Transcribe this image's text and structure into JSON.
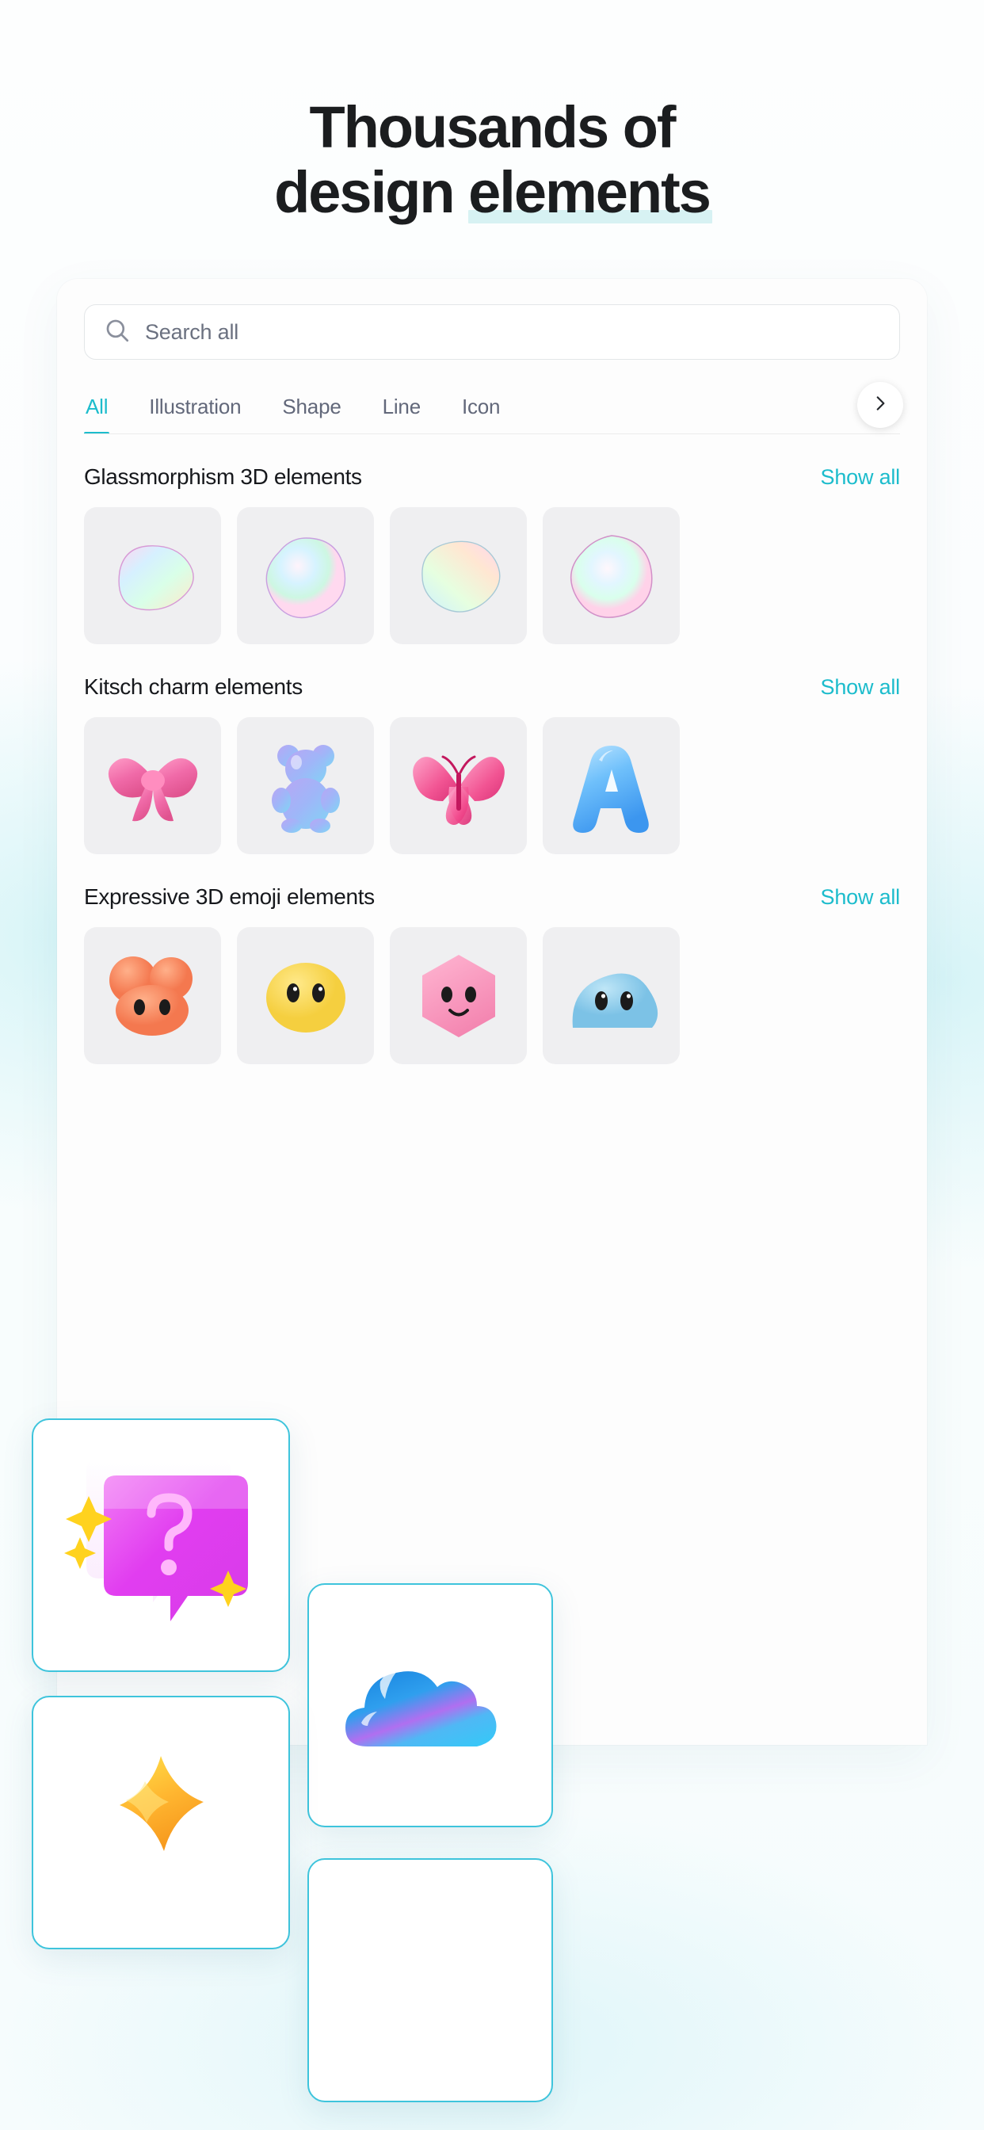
{
  "headline": {
    "line1": "Thousands of",
    "line2_pre": "design ",
    "line2_mark": "elements"
  },
  "colors": {
    "accent": "#1cbccc",
    "highlight": "#d7f2f3",
    "card_border": "#3ec4dc",
    "text": "#16181c",
    "muted": "#62687a"
  },
  "app": {
    "search": {
      "placeholder": "Search all",
      "icon": "search-icon"
    },
    "tabs": [
      {
        "label": "All",
        "active": true
      },
      {
        "label": "Illustration",
        "active": false
      },
      {
        "label": "Shape",
        "active": false
      },
      {
        "label": "Line",
        "active": false
      },
      {
        "label": "Icon",
        "active": false
      }
    ],
    "tab_next_icon": "chevron-right-icon",
    "sections": [
      {
        "title": "Glassmorphism 3D elements",
        "show_all": "Show all",
        "items": [
          {
            "name": "iridescent-blob-1"
          },
          {
            "name": "iridescent-blob-2"
          },
          {
            "name": "iridescent-blob-3"
          },
          {
            "name": "iridescent-blob-4"
          }
        ]
      },
      {
        "title": "Kitsch charm elements",
        "show_all": "Show all",
        "items": [
          {
            "name": "pink-bow"
          },
          {
            "name": "gummy-bear"
          },
          {
            "name": "pink-butterfly"
          },
          {
            "name": "blue-letter-a"
          }
        ]
      },
      {
        "title": "Expressive 3D emoji elements",
        "show_all": "Show all",
        "items": [
          {
            "name": "orange-fuzzy-blob"
          },
          {
            "name": "yellow-fuzzy-face"
          },
          {
            "name": "pink-hexagon-face"
          },
          {
            "name": "blue-fuzzy-blob"
          }
        ]
      }
    ]
  },
  "floating_cards": [
    {
      "name": "question-speech-bubble-card"
    },
    {
      "name": "gradient-cloud-card"
    },
    {
      "name": "gold-star-card"
    },
    {
      "name": "partial-card"
    }
  ]
}
